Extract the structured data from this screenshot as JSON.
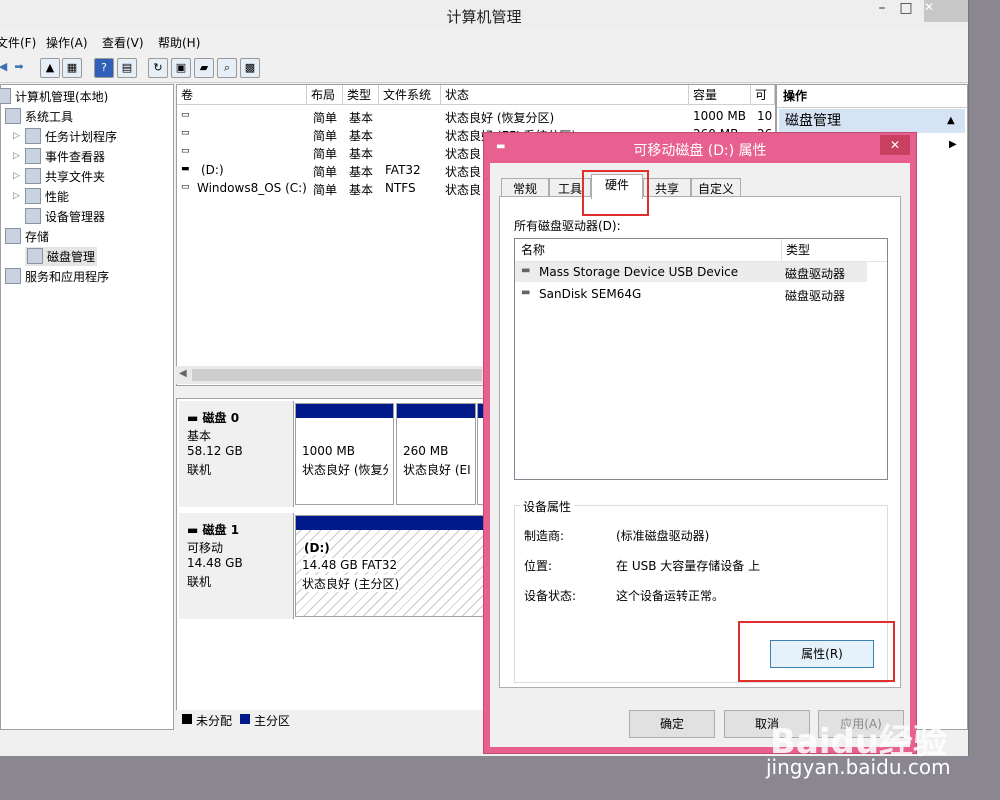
{
  "window": {
    "title": "计算机管理"
  },
  "menu": [
    "文件(F)",
    "操作(A)",
    "查看(V)",
    "帮助(H)"
  ],
  "tree": {
    "root": "计算机管理(本地)",
    "items": [
      {
        "label": "系统工具",
        "level": 1
      },
      {
        "label": "任务计划程序",
        "level": 2
      },
      {
        "label": "事件查看器",
        "level": 2
      },
      {
        "label": "共享文件夹",
        "level": 2
      },
      {
        "label": "性能",
        "level": 2
      },
      {
        "label": "设备管理器",
        "level": 2
      },
      {
        "label": "存储",
        "level": 1
      },
      {
        "label": "磁盘管理",
        "level": 2
      },
      {
        "label": "服务和应用程序",
        "level": 1
      }
    ]
  },
  "volumes": {
    "headers": [
      "卷",
      "布局",
      "类型",
      "文件系统",
      "状态",
      "容量",
      "可"
    ],
    "rows": [
      {
        "vol": "",
        "layout": "简单",
        "type": "基本",
        "fs": "",
        "status": "状态良好 (恢复分区)",
        "cap": "1000 MB",
        "avail": "10"
      },
      {
        "vol": "",
        "layout": "简单",
        "type": "基本",
        "fs": "",
        "status": "状态良好 (EFI 系统分区)",
        "cap": "260 MB",
        "avail": "26"
      },
      {
        "vol": "",
        "layout": "简单",
        "type": "基本",
        "fs": "",
        "status": "状态良",
        "cap": "",
        "avail": ""
      },
      {
        "vol": "(D:)",
        "layout": "简单",
        "type": "基本",
        "fs": "FAT32",
        "status": "状态良",
        "cap": "",
        "avail": ""
      },
      {
        "vol": "Windows8_OS (C:)",
        "layout": "简单",
        "type": "基本",
        "fs": "NTFS",
        "status": "状态良",
        "cap": "",
        "avail": ""
      }
    ]
  },
  "disk0": {
    "name": "磁盘 0",
    "type": "基本",
    "size": "58.12 GB",
    "state": "联机",
    "partitions": [
      {
        "size": "1000 MB",
        "status": "状态良好 (恢复分"
      },
      {
        "size": "260 MB",
        "status": "状态良好 (EI"
      }
    ]
  },
  "disk1": {
    "name": "磁盘 1",
    "type": "可移动",
    "size": "14.48 GB",
    "state": "联机",
    "partition": {
      "label": "(D:)",
      "size": "14.48 GB FAT32",
      "status": "状态良好 (主分区)"
    }
  },
  "legend": {
    "unallocated": "未分配",
    "primary": "主分区"
  },
  "actions": {
    "header": "操作",
    "section": "磁盘管理"
  },
  "dialog": {
    "title": "可移动磁盘 (D:) 属性",
    "tabs": [
      "常规",
      "工具",
      "硬件",
      "共享",
      "自定义"
    ],
    "active_tab": "硬件",
    "drives_label": "所有磁盘驱动器(D):",
    "col_name": "名称",
    "col_type": "类型",
    "drives": [
      {
        "name": "Mass Storage Device USB Device",
        "type": "磁盘驱动器"
      },
      {
        "name": "SanDisk SEM64G",
        "type": "磁盘驱动器"
      }
    ],
    "props_group": "设备属性",
    "props": [
      {
        "label": "制造商:",
        "value": "(标准磁盘驱动器)"
      },
      {
        "label": "位置:",
        "value": "在 USB 大容量存储设备 上"
      },
      {
        "label": "设备状态:",
        "value": "这个设备运转正常。"
      }
    ],
    "properties_button": "属性(R)",
    "ok": "确定",
    "cancel": "取消",
    "apply": "应用(A)"
  },
  "watermark": {
    "brand": "Baidu经验",
    "url": "jingyan.baidu.com"
  },
  "colors": {
    "primary_partition": "#001a8c",
    "dialog_frame": "#e8608f",
    "highlight_box": "#e0302e"
  }
}
